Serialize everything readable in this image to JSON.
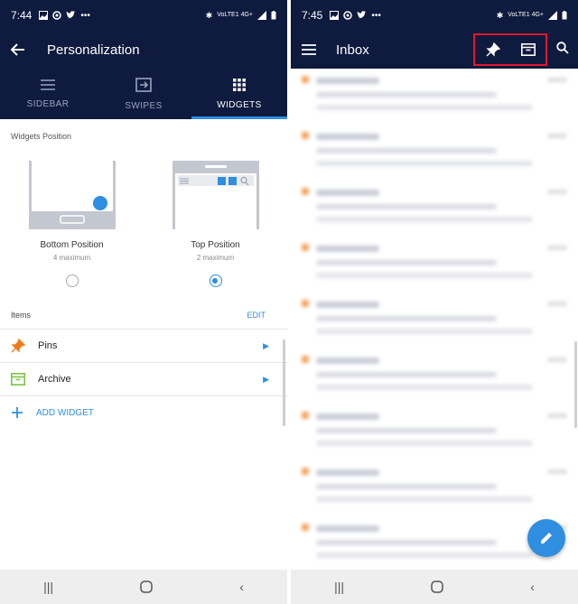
{
  "left": {
    "status": {
      "time": "7:44",
      "net": "VoLTE1 4G+"
    },
    "appbar": {
      "title": "Personalization"
    },
    "tabs": [
      {
        "label": "SIDEBAR",
        "icon": "hamburger-icon"
      },
      {
        "label": "SWIPES",
        "icon": "swipe-icon"
      },
      {
        "label": "WIDGETS",
        "icon": "grid-icon",
        "active": true
      }
    ],
    "widgets_position_label": "Widgets Position",
    "positions": [
      {
        "name": "Bottom Position",
        "sub": "4 maximum",
        "selected": false
      },
      {
        "name": "Top Position",
        "sub": "2 maximum",
        "selected": true
      }
    ],
    "items_label": "Items",
    "edit_label": "EDIT",
    "items": [
      {
        "label": "Pins",
        "icon": "pin-icon",
        "color": "#f07a1a"
      },
      {
        "label": "Archive",
        "icon": "archive-icon",
        "color": "#7dc242"
      }
    ],
    "add_widget": "ADD WIDGET"
  },
  "right": {
    "status": {
      "time": "7:45",
      "net": "VoLTE1 4G+"
    },
    "appbar": {
      "title": "Inbox"
    },
    "highlight_color": "#e0182b",
    "mail_count": 9
  },
  "colors": {
    "primary": "#0e1a3e",
    "accent": "#2f8ee0"
  }
}
